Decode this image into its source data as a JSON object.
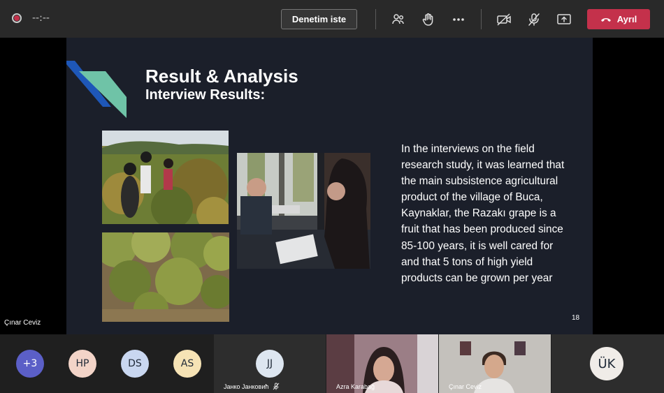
{
  "toolbar": {
    "timer": "--:--",
    "control_button": "Denetim iste",
    "leave_button": "Ayrıl",
    "icons": [
      "participants-icon",
      "raise-hand-icon",
      "more-options-icon",
      "camera-off-icon",
      "mic-off-icon",
      "share-screen-icon",
      "phone-hangup-icon"
    ],
    "leave_color": "#c4314b"
  },
  "slide": {
    "title": "Result & Analysis",
    "subtitle": "Interview Results:",
    "body": "In the interviews on the field research study, it was learned that the main subsistence agricultural product of the village of Buca, Kaynaklar, the Razakı grape is a fruit that has been produced since 85-100 years, it is well cared for and that 5 tons of high yield products can be grown per year",
    "page_number": "18",
    "accent_colors": [
      "#1e57b8",
      "#6fc3a7"
    ]
  },
  "presenter_name": "Çınar Ceviz",
  "participants": {
    "overflow": "+3",
    "avatars": [
      {
        "initials": "HP",
        "color": "#f3d4c8"
      },
      {
        "initials": "DS",
        "color": "#c9d7f0"
      },
      {
        "initials": "AS",
        "color": "#f6e3b5"
      }
    ],
    "tiles": [
      {
        "initials": "JJ",
        "name": "Јанко Јанковић",
        "muted": true
      },
      {
        "name": "Azra Karabağ"
      },
      {
        "name": "Çınar Ceviz"
      },
      {
        "initials": "ÜK"
      }
    ]
  }
}
